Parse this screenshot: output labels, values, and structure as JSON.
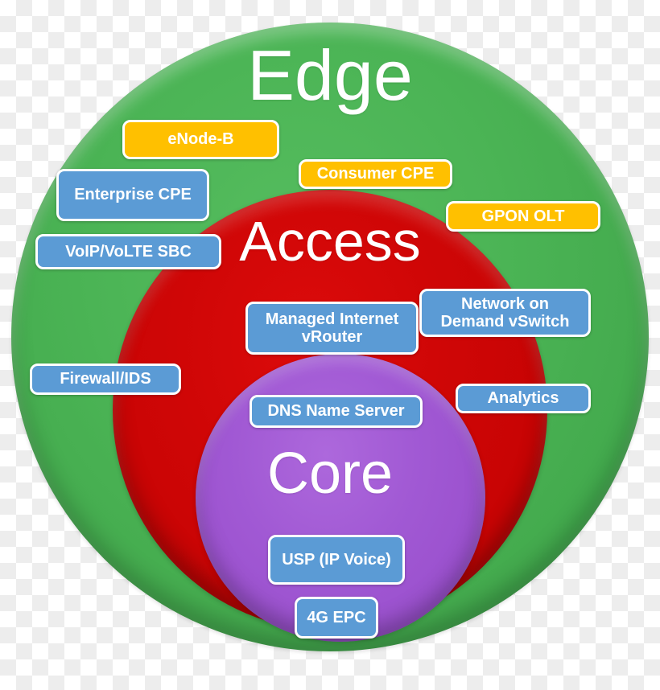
{
  "diagram": {
    "type": "concentric-venn",
    "zones": [
      {
        "id": "edge",
        "title": "Edge",
        "color": "#4bb455"
      },
      {
        "id": "access",
        "title": "Access",
        "color": "#cc0505"
      },
      {
        "id": "core",
        "title": "Core",
        "color": "#9b51ce"
      }
    ],
    "colors": {
      "edge_green": "#4bb455",
      "access_red": "#cc0505",
      "core_purple": "#9b51ce",
      "label_blue": "#5b9bd5",
      "label_orange": "#ffc000",
      "label_border": "#ffffff",
      "text_white": "#ffffff"
    },
    "labels": [
      {
        "id": "enodeb",
        "text": "eNode-B",
        "style": "orange",
        "zone": "edge"
      },
      {
        "id": "consumer-cpe",
        "text": "Consumer CPE",
        "style": "orange",
        "zone": "edge"
      },
      {
        "id": "gpon-olt",
        "text": "GPON OLT",
        "style": "orange",
        "zone": "edge"
      },
      {
        "id": "enterprise-cpe",
        "text": "Enterprise CPE",
        "style": "blue",
        "zone": "edge"
      },
      {
        "id": "voip-volte-sbc",
        "text": "VoIP/VoLTE SBC",
        "style": "blue",
        "zone": "edge"
      },
      {
        "id": "managed-router",
        "line1": "Managed Internet",
        "line2": "vRouter",
        "style": "blue",
        "zone": "access"
      },
      {
        "id": "network-demand",
        "line1": "Network on",
        "line2": "Demand vSwitch",
        "style": "blue",
        "zone": "access"
      },
      {
        "id": "firewall-ids",
        "text": "Firewall/IDS",
        "style": "blue",
        "zone": "edge"
      },
      {
        "id": "dns-name-server",
        "text": "DNS Name Server",
        "style": "blue",
        "zone": "core"
      },
      {
        "id": "analytics",
        "text": "Analytics",
        "style": "blue",
        "zone": "access"
      },
      {
        "id": "usp-ip-voice",
        "text": "USP (IP Voice)",
        "style": "blue",
        "zone": "core"
      },
      {
        "id": "4g-epc",
        "text": "4G EPC",
        "style": "blue",
        "zone": "core"
      }
    ]
  }
}
